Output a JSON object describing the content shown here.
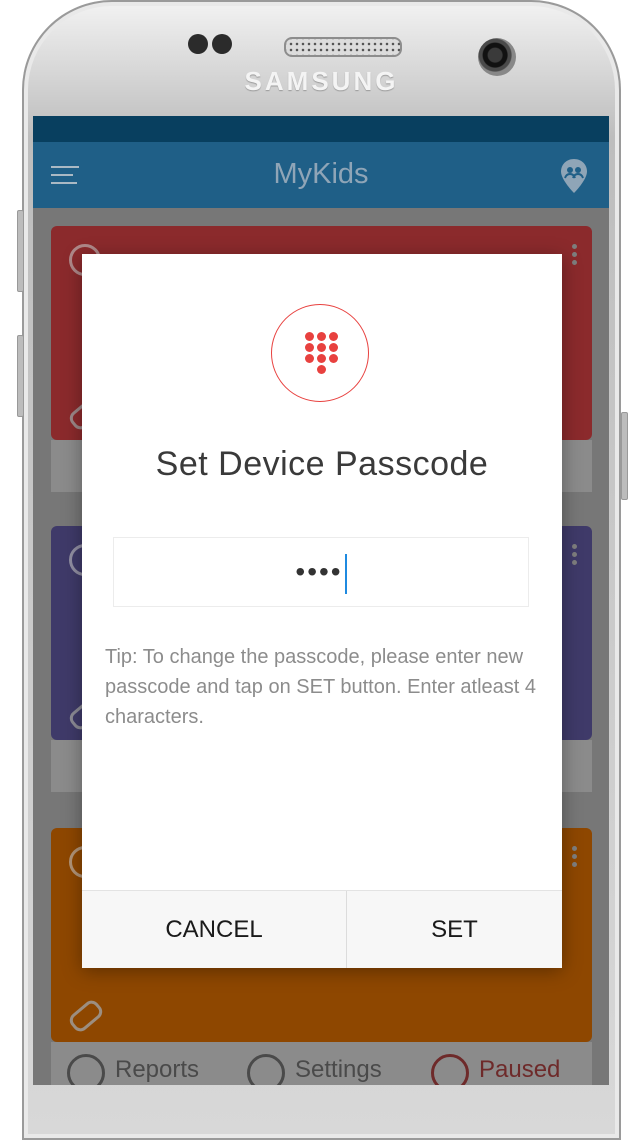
{
  "device": {
    "brand": "SAMSUNG"
  },
  "app": {
    "title": "MyKids",
    "menu_icon": "hamburger-menu-icon",
    "locate_icon": "family-locate-icon"
  },
  "cards": [
    {
      "color": "#8b2a2c"
    },
    {
      "color": "#3f3a69"
    },
    {
      "color": "#8e4700"
    }
  ],
  "bottom_tabs": {
    "reports": "Reports",
    "settings": "Settings",
    "paused": "Paused"
  },
  "dialog": {
    "icon": "keypad-icon",
    "title": "Set Device Passcode",
    "passcode_value": "••••",
    "tip": "Tip: To change the passcode, please enter new passcode and tap on SET button. Enter atleast 4 characters.",
    "cancel_label": "CANCEL",
    "set_label": "SET"
  },
  "colors": {
    "appbar": "#1f5f87",
    "accent": "#e8413f",
    "caret": "#1f8ae0"
  }
}
